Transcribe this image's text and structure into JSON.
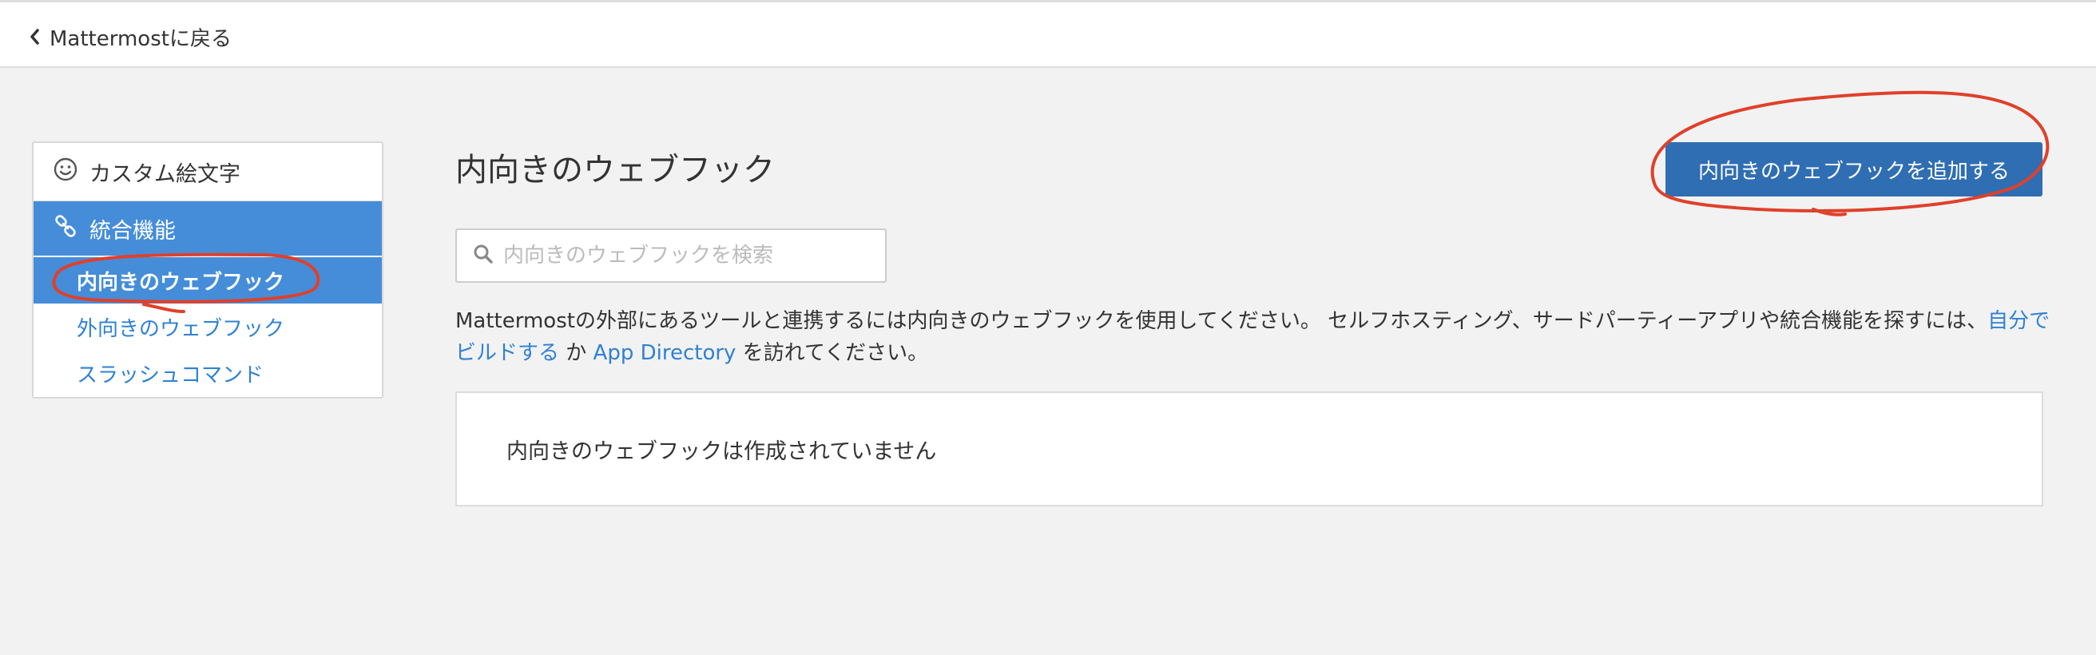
{
  "header": {
    "back_label": "Mattermostに戻る"
  },
  "sidebar": {
    "custom_emoji": "カスタム絵文字",
    "integrations": "統合機能",
    "incoming_webhooks": "内向きのウェブフック",
    "outgoing_webhooks": "外向きのウェブフック",
    "slash_commands": "スラッシュコマンド"
  },
  "main": {
    "title": "内向きのウェブフック",
    "add_button": "内向きのウェブフックを追加する",
    "search_placeholder": "内向きのウェブフックを検索",
    "description": {
      "text_before": "Mattermostの外部にあるツールと連携するには内向きのウェブフックを使用してください。 セルフホスティング、サードパーティーアプリや統合機能を探すには、",
      "link_self_build": "自分でビルドする",
      "text_middle": " か ",
      "link_app_directory": "App Directory",
      "text_after": " を訪れてください。"
    },
    "empty_message": "内向きのウェブフックは作成されていません"
  },
  "colors": {
    "accent": "#458dd9",
    "button": "#2f6eb3",
    "link": "#2f81d5",
    "annotation": "#e0402a",
    "background": "#f2f2f2"
  },
  "icons": {
    "back": "chevron-left-icon",
    "emoji": "smiley-icon",
    "integrations": "link-icon",
    "search": "search-icon"
  }
}
